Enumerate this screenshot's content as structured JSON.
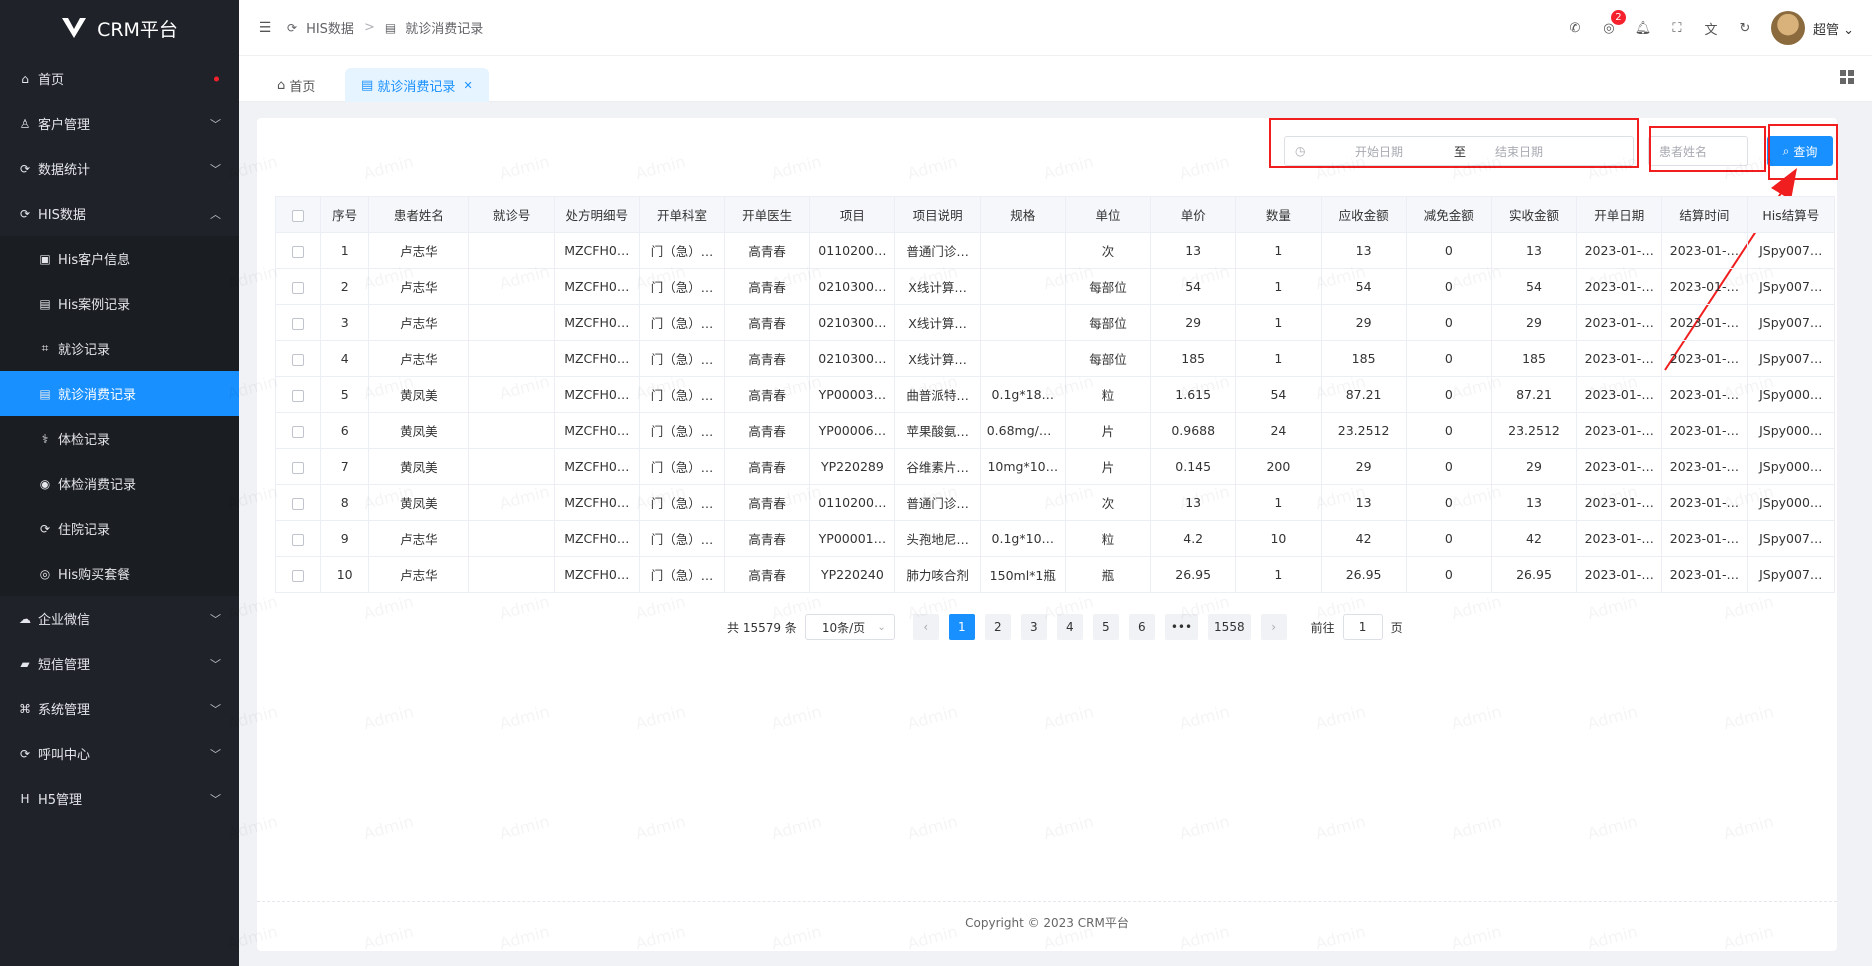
{
  "app": {
    "title": "CRM平台"
  },
  "sidebar": {
    "items": [
      {
        "label": "首页",
        "icon": "home-icon",
        "has_dot": true
      },
      {
        "label": "客户管理",
        "icon": "user-icon",
        "chevron": "down"
      },
      {
        "label": "数据统计",
        "icon": "stats-icon",
        "chevron": "down"
      },
      {
        "label": "HIS数据",
        "icon": "his-icon",
        "chevron": "up"
      },
      {
        "label": "His客户信息",
        "icon": "id-card-icon",
        "sub": true
      },
      {
        "label": "His案例记录",
        "icon": "doc-icon",
        "sub": true
      },
      {
        "label": "就诊记录",
        "icon": "scan-icon",
        "sub": true
      },
      {
        "label": "就诊消费记录",
        "icon": "receipt-icon",
        "sub": true,
        "active": true
      },
      {
        "label": "体检记录",
        "icon": "checkup-icon",
        "sub": true
      },
      {
        "label": "体检消费记录",
        "icon": "coin-icon",
        "sub": true
      },
      {
        "label": "住院记录",
        "icon": "bed-icon",
        "sub": true
      },
      {
        "label": "His购买套餐",
        "icon": "package-icon",
        "sub": true
      },
      {
        "label": "企业微信",
        "icon": "wechat-icon",
        "chevron": "down"
      },
      {
        "label": "短信管理",
        "icon": "sms-icon",
        "chevron": "down"
      },
      {
        "label": "系统管理",
        "icon": "system-icon",
        "chevron": "down"
      },
      {
        "label": "呼叫中心",
        "icon": "phone-icon",
        "chevron": "down"
      },
      {
        "label": "H5管理",
        "icon": "h5-icon",
        "chevron": "down"
      }
    ]
  },
  "header": {
    "breadcrumb": [
      "HIS数据",
      "就诊消费记录"
    ],
    "notification_count": "2",
    "user_name": "超管"
  },
  "tabs": [
    {
      "label": "首页",
      "icon": "home-icon"
    },
    {
      "label": "就诊消费记录",
      "icon": "receipt-icon",
      "active": true
    }
  ],
  "search": {
    "start_placeholder": "开始日期",
    "range_sep": "至",
    "end_placeholder": "结束日期",
    "patient_placeholder": "患者姓名",
    "query_label": "查询"
  },
  "table": {
    "columns": [
      "序号",
      "患者姓名",
      "就诊号",
      "处方明细号",
      "开单科室",
      "开单医生",
      "项目",
      "项目说明",
      "规格",
      "单位",
      "单价",
      "数量",
      "应收金额",
      "减免金额",
      "实收金额",
      "开单日期",
      "结算时间",
      "His结算号"
    ],
    "rows": [
      [
        "1",
        "卢志华",
        "",
        "MZCFH0…",
        "门（急）…",
        "高青春",
        "0110200…",
        "普通门诊…",
        "",
        "次",
        "13",
        "1",
        "13",
        "0",
        "13",
        "2023-01-…",
        "2023-01-…",
        "JSpy007…"
      ],
      [
        "2",
        "卢志华",
        "",
        "MZCFH0…",
        "门（急）…",
        "高青春",
        "0210300…",
        "X线计算…",
        "",
        "每部位",
        "54",
        "1",
        "54",
        "0",
        "54",
        "2023-01-…",
        "2023-01-…",
        "JSpy007…"
      ],
      [
        "3",
        "卢志华",
        "",
        "MZCFH0…",
        "门（急）…",
        "高青春",
        "0210300…",
        "X线计算…",
        "",
        "每部位",
        "29",
        "1",
        "29",
        "0",
        "29",
        "2023-01-…",
        "2023-01-…",
        "JSpy007…"
      ],
      [
        "4",
        "卢志华",
        "",
        "MZCFH0…",
        "门（急）…",
        "高青春",
        "0210300…",
        "X线计算…",
        "",
        "每部位",
        "185",
        "1",
        "185",
        "0",
        "185",
        "2023-01-…",
        "2023-01-…",
        "JSpy007…"
      ],
      [
        "5",
        "黄凤美",
        "",
        "MZCFH0…",
        "门（急）…",
        "高青春",
        "YP00003…",
        "曲普派特…",
        "0.1g*18…",
        "粒",
        "1.615",
        "54",
        "87.21",
        "0",
        "87.21",
        "2023-01-…",
        "2023-01-…",
        "JSpy000…"
      ],
      [
        "6",
        "黄凤美",
        "",
        "MZCFH0…",
        "门（急）…",
        "高青春",
        "YP00006…",
        "苹果酸氨…",
        "0.68mg/2…",
        "片",
        "0.9688",
        "24",
        "23.2512",
        "0",
        "23.2512",
        "2023-01-…",
        "2023-01-…",
        "JSpy000…"
      ],
      [
        "7",
        "黄凤美",
        "",
        "MZCFH0…",
        "门（急）…",
        "高青春",
        "YP220289",
        "谷维素片…",
        "10mg*10…",
        "片",
        "0.145",
        "200",
        "29",
        "0",
        "29",
        "2023-01-…",
        "2023-01-…",
        "JSpy000…"
      ],
      [
        "8",
        "黄凤美",
        "",
        "MZCFH0…",
        "门（急）…",
        "高青春",
        "0110200…",
        "普通门诊…",
        "",
        "次",
        "13",
        "1",
        "13",
        "0",
        "13",
        "2023-01-…",
        "2023-01-…",
        "JSpy000…"
      ],
      [
        "9",
        "卢志华",
        "",
        "MZCFH0…",
        "门（急）…",
        "高青春",
        "YP00001…",
        "头孢地尼…",
        "0.1g*10…",
        "粒",
        "4.2",
        "10",
        "42",
        "0",
        "42",
        "2023-01-…",
        "2023-01-…",
        "JSpy007…"
      ],
      [
        "10",
        "卢志华",
        "",
        "MZCFH0…",
        "门（急）…",
        "高青春",
        "YP220240",
        "肺力咳合剂",
        "150ml*1瓶",
        "瓶",
        "26.95",
        "1",
        "26.95",
        "0",
        "26.95",
        "2023-01-…",
        "2023-01-…",
        "JSpy007…"
      ]
    ]
  },
  "pagination": {
    "total_text": "共 15579 条",
    "page_size": "10条/页",
    "pages": [
      "1",
      "2",
      "3",
      "4",
      "5",
      "6",
      "•••",
      "1558"
    ],
    "current": "1",
    "goto_label": "前往",
    "goto_value": "1",
    "page_suffix": "页"
  },
  "footer": {
    "copyright": "Copyright © 2023 CRM平台"
  },
  "watermark": "Admin",
  "colors": {
    "sidebar_bg": "#1f2329",
    "primary": "#1890ff",
    "highlight_red": "#f01e1e"
  }
}
